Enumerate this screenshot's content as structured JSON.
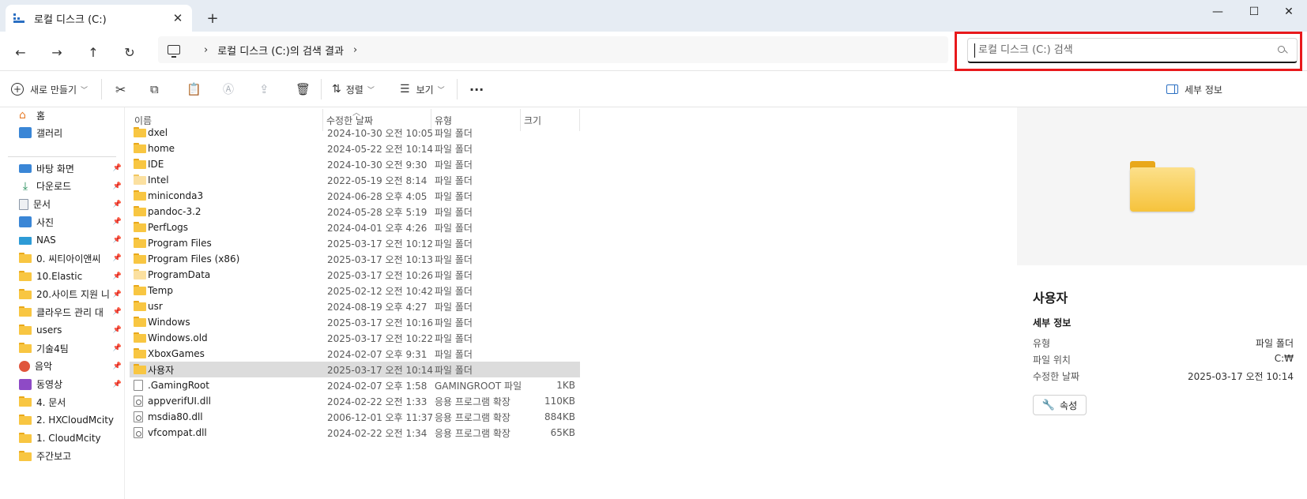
{
  "tab": {
    "title": "로컬 디스크 (C:)",
    "close": "✕",
    "new": "+"
  },
  "window": {
    "minimize": "—",
    "maximize": "☐",
    "close": "✕"
  },
  "nav": {
    "back": "←",
    "forward": "→",
    "up": "↑",
    "refresh": "↻"
  },
  "address": {
    "separator": "›",
    "path": "로컬 디스크 (C:)의 검색 결과",
    "trail": "›"
  },
  "search": {
    "placeholder": "로컬 디스크 (C:) 검색"
  },
  "toolbar": {
    "new_label": "새로 만들기",
    "sort_label": "정렬",
    "view_label": "보기",
    "more_label": "···",
    "details_label": "세부 정보"
  },
  "sidebar": {
    "top": [
      {
        "label": "홈",
        "icon": "home-icon"
      },
      {
        "label": "갤러리",
        "icon": "gallery-icon"
      }
    ],
    "items": [
      {
        "label": "바탕 화면",
        "icon": "desktop-icon",
        "pinned": true
      },
      {
        "label": "다운로드",
        "icon": "download-icon",
        "pinned": true
      },
      {
        "label": "문서",
        "icon": "documents-icon",
        "pinned": true
      },
      {
        "label": "사진",
        "icon": "pictures-icon",
        "pinned": true
      },
      {
        "label": "NAS",
        "icon": "network-drive-icon",
        "pinned": true
      },
      {
        "label": "0. 씨티아이앤씨",
        "icon": "folder-icon",
        "pinned": true
      },
      {
        "label": "10.Elastic",
        "icon": "folder-icon",
        "pinned": true
      },
      {
        "label": "20.사이트 지원 니",
        "icon": "folder-icon",
        "pinned": true
      },
      {
        "label": "클라우드 관리 대",
        "icon": "folder-icon",
        "pinned": true
      },
      {
        "label": "users",
        "icon": "folder-icon",
        "pinned": true
      },
      {
        "label": "기술4팀",
        "icon": "folder-icon",
        "pinned": true
      },
      {
        "label": "음악",
        "icon": "music-icon",
        "pinned": true
      },
      {
        "label": "동영상",
        "icon": "videos-icon",
        "pinned": true
      },
      {
        "label": "4. 문서",
        "icon": "folder-icon",
        "pinned": false
      },
      {
        "label": "2. HXCloudMcity",
        "icon": "folder-icon",
        "pinned": false
      },
      {
        "label": "1. CloudMcity",
        "icon": "folder-icon",
        "pinned": false
      },
      {
        "label": "주간보고",
        "icon": "folder-icon",
        "pinned": false
      }
    ],
    "pin_glyph": "📌"
  },
  "columns": {
    "name": "이름",
    "date": "수정한 날짜",
    "type": "유형",
    "size": "크기"
  },
  "files": [
    {
      "name": "dxel",
      "date": "2024-10-30 오전 10:05",
      "type": "파일 폴더",
      "size": "",
      "kind": "folder"
    },
    {
      "name": "home",
      "date": "2024-05-22 오전 10:14",
      "type": "파일 폴더",
      "size": "",
      "kind": "folder"
    },
    {
      "name": "IDE",
      "date": "2024-10-30 오전 9:30",
      "type": "파일 폴더",
      "size": "",
      "kind": "folder"
    },
    {
      "name": "Intel",
      "date": "2022-05-19 오전 8:14",
      "type": "파일 폴더",
      "size": "",
      "kind": "folder-light"
    },
    {
      "name": "miniconda3",
      "date": "2024-06-28 오후 4:05",
      "type": "파일 폴더",
      "size": "",
      "kind": "folder"
    },
    {
      "name": "pandoc-3.2",
      "date": "2024-05-28 오후 5:19",
      "type": "파일 폴더",
      "size": "",
      "kind": "folder"
    },
    {
      "name": "PerfLogs",
      "date": "2024-04-01 오후 4:26",
      "type": "파일 폴더",
      "size": "",
      "kind": "folder"
    },
    {
      "name": "Program Files",
      "date": "2025-03-17 오전 10:12",
      "type": "파일 폴더",
      "size": "",
      "kind": "folder"
    },
    {
      "name": "Program Files (x86)",
      "date": "2025-03-17 오전 10:13",
      "type": "파일 폴더",
      "size": "",
      "kind": "folder"
    },
    {
      "name": "ProgramData",
      "date": "2025-03-17 오전 10:26",
      "type": "파일 폴더",
      "size": "",
      "kind": "folder-light"
    },
    {
      "name": "Temp",
      "date": "2025-02-12 오전 10:42",
      "type": "파일 폴더",
      "size": "",
      "kind": "folder"
    },
    {
      "name": "usr",
      "date": "2024-08-19 오후 4:27",
      "type": "파일 폴더",
      "size": "",
      "kind": "folder"
    },
    {
      "name": "Windows",
      "date": "2025-03-17 오전 10:16",
      "type": "파일 폴더",
      "size": "",
      "kind": "folder"
    },
    {
      "name": "Windows.old",
      "date": "2025-03-17 오전 10:22",
      "type": "파일 폴더",
      "size": "",
      "kind": "folder"
    },
    {
      "name": "XboxGames",
      "date": "2024-02-07 오후 9:31",
      "type": "파일 폴더",
      "size": "",
      "kind": "folder"
    },
    {
      "name": "사용자",
      "date": "2025-03-17 오전 10:14",
      "type": "파일 폴더",
      "size": "",
      "kind": "folder",
      "selected": true
    },
    {
      "name": ".GamingRoot",
      "date": "2024-02-07 오후 1:58",
      "type": "GAMINGROOT 파일",
      "size": "1KB",
      "kind": "file"
    },
    {
      "name": "appverifUI.dll",
      "date": "2024-02-22 오전 1:33",
      "type": "응용 프로그램 확장",
      "size": "110KB",
      "kind": "dll"
    },
    {
      "name": "msdia80.dll",
      "date": "2006-12-01 오후 11:37",
      "type": "응용 프로그램 확장",
      "size": "884KB",
      "kind": "dll"
    },
    {
      "name": "vfcompat.dll",
      "date": "2024-02-22 오전 1:34",
      "type": "응용 프로그램 확장",
      "size": "65KB",
      "kind": "dll"
    }
  ],
  "details": {
    "title": "사용자",
    "section": "세부 정보",
    "type_label": "유형",
    "type_value": "파일 폴더",
    "location_label": "파일 위치",
    "location_value": "C:₩",
    "modified_label": "수정한 날짜",
    "modified_value": "2025-03-17 오전 10:14",
    "properties_label": "속성"
  },
  "colors": {
    "accent": "#2b6fc2",
    "highlight": "#e8191c",
    "folder": "#f8c642",
    "selected_row": "#dcdcdc"
  }
}
